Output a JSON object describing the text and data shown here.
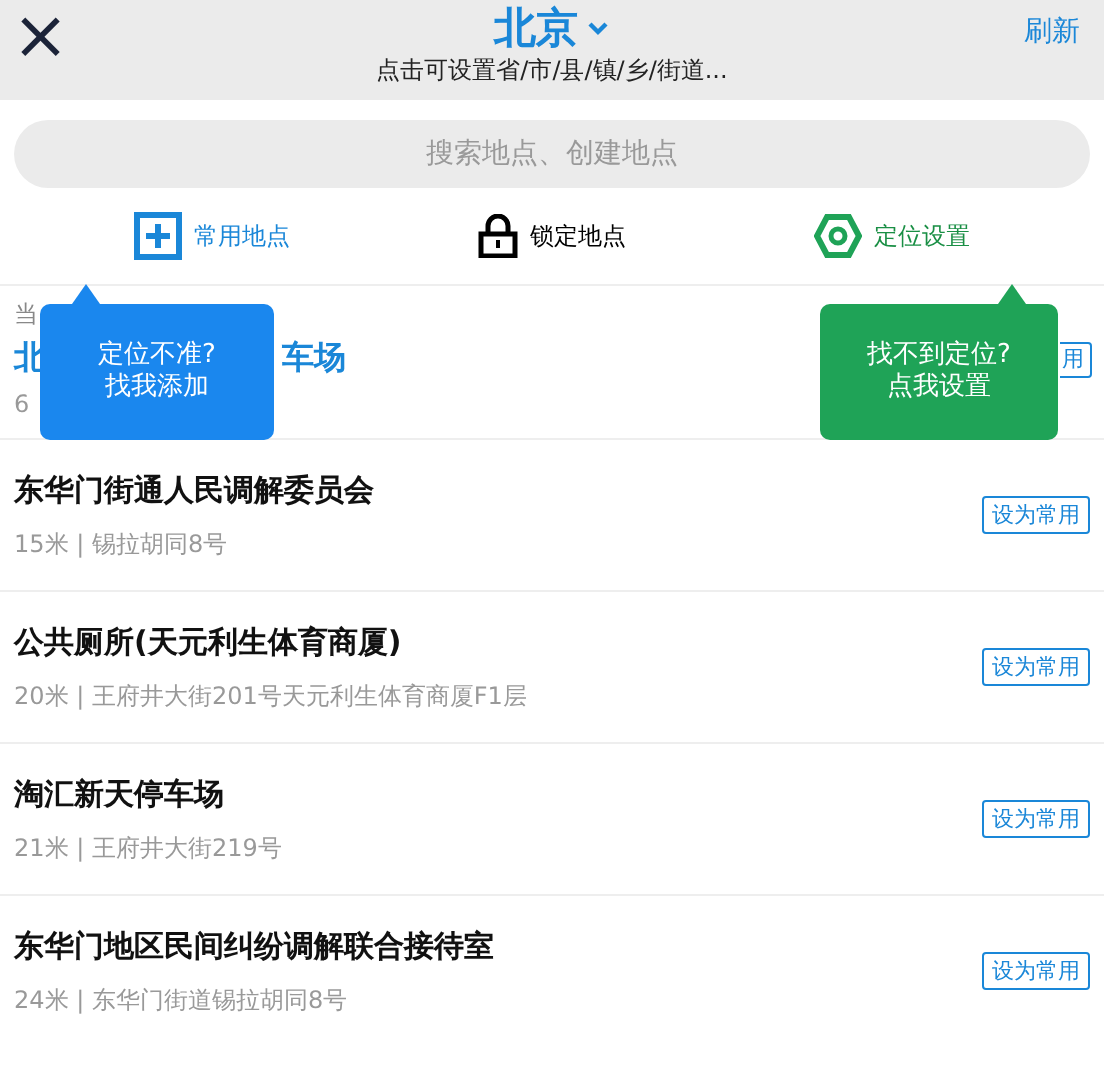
{
  "header": {
    "close": "×",
    "city": "北京",
    "subtitle": "点击可设置省/市/县/镇/乡/街道...",
    "refresh": "刷新"
  },
  "search": {
    "placeholder": "搜索地点、创建地点"
  },
  "actions": [
    {
      "kind": "plus",
      "label": "常用地点"
    },
    {
      "kind": "lock",
      "label": "锁定地点"
    },
    {
      "kind": "hexagon",
      "label": "定位设置"
    }
  ],
  "current": {
    "label": "当",
    "title_start": "北",
    "title_end": "车场",
    "distance": "6",
    "button": "用"
  },
  "tips": [
    {
      "line1": "定位不准?",
      "line2": "找我添加",
      "color": "#1a87ee"
    },
    {
      "line1": "找不到定位?",
      "line2": "点我设置",
      "color": "#1fa357"
    }
  ],
  "places": [
    {
      "name": "东华门街通人民调解委员会",
      "detail": "15米 | 锡拉胡同8号",
      "button": "设为常用"
    },
    {
      "name": "公共厕所(天元利生体育商厦)",
      "detail": "20米 | 王府井大街201号天元利生体育商厦F1层",
      "button": "设为常用"
    },
    {
      "name": "淘汇新天停车场",
      "detail": "21米 | 王府井大街219号",
      "button": "设为常用"
    },
    {
      "name": "东华门地区民间纠纷调解联合接待室",
      "detail": "24米 | 东华门街道锡拉胡同8号",
      "button": "设为常用"
    }
  ]
}
